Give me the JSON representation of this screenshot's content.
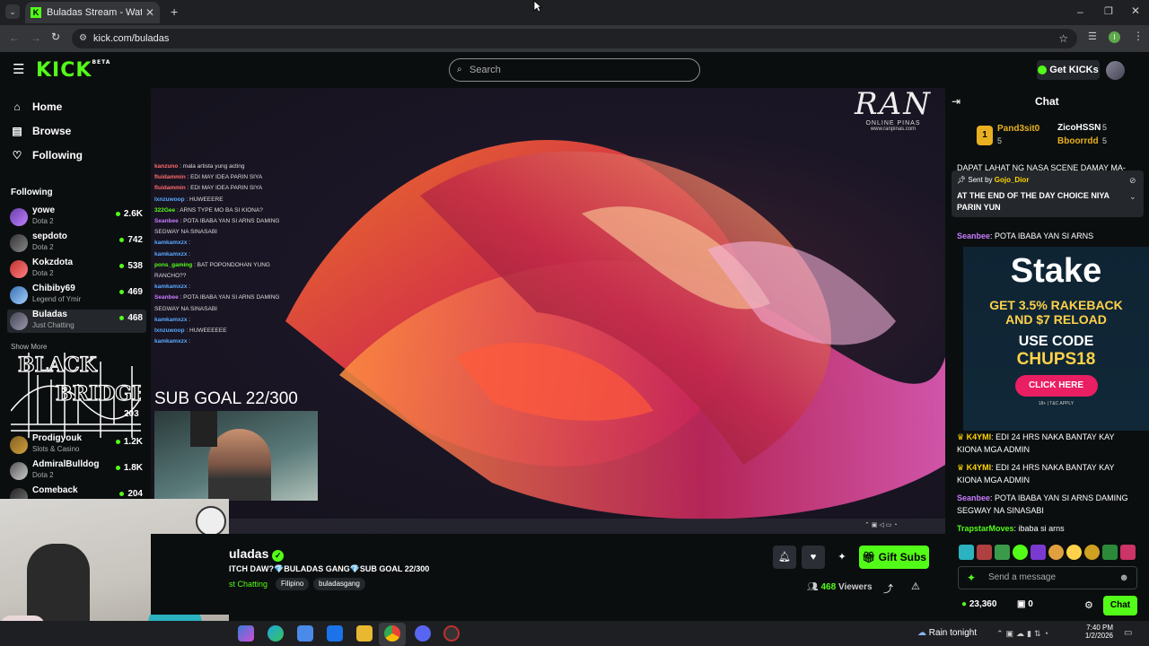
{
  "browser": {
    "tab_title": "Buladas Stream - Watch Live o",
    "url": "kick.com/buladas",
    "new_tab": "+",
    "close_tab": "✕"
  },
  "kick": {
    "logo": "KICK",
    "logo_badge": "BETA",
    "search_placeholder": "Search",
    "get_kicks": "Get KICKs"
  },
  "sidebar": {
    "nav": [
      {
        "label": "Home"
      },
      {
        "label": "Browse"
      },
      {
        "label": "Following"
      }
    ],
    "following_heading": "Following",
    "channels": [
      {
        "name": "yowe",
        "category": "Dota 2",
        "viewers": "2.6K"
      },
      {
        "name": "sepdoto",
        "category": "Dota 2",
        "viewers": "742"
      },
      {
        "name": "Kokzdota",
        "category": "Dota 2",
        "viewers": "538"
      },
      {
        "name": "Chibiby69",
        "category": "Legend of Ymir",
        "viewers": "469"
      },
      {
        "name": "Buladas",
        "category": "Just Chatting",
        "viewers": "468"
      }
    ],
    "show_more": "Show More",
    "partial_viewers_1": "203",
    "partial_viewers_2": "1.2K",
    "partial_name_2": "Prodigyouk",
    "partial_cat_2": "Slots & Casino",
    "channels_2": [
      {
        "name": "AdmiralBulldog",
        "category": "Dota 2",
        "viewers": "1.8K"
      },
      {
        "name": "Comeback",
        "category": "",
        "viewers": "204"
      }
    ]
  },
  "video": {
    "logo_text": "RAN",
    "logo_sub": "ONLINE PINAS",
    "logo_url": "www.ranpinas.com",
    "sub_goal": "SUB GOAL 22/300",
    "black_bridge_line1": "BLACK",
    "black_bridge_line2": "BRIDGE",
    "overlay_chat": [
      {
        "user": "kanzuno",
        "text": "mala artista yung acting",
        "color": "#ff6b6b"
      },
      {
        "user": "fluidammin",
        "text": "EDI MAY IDEA PARIN SIYA",
        "color": "#ff6b6b"
      },
      {
        "user": "fluidammin",
        "text": "EDI MAY IDEA PARIN SIYA",
        "color": "#ff6b6b"
      },
      {
        "user": "lxnzuwoop",
        "text": "HUWEEERE",
        "color": "#5aa9ff"
      },
      {
        "user": "322Gee",
        "text": "ARNS TYPE MO BA SI KIONA?",
        "color": "#53fc18"
      },
      {
        "user": "Seanbee",
        "text": "POTA IBABA YAN SI ARNS DAMING SEGWAY NA SINASABI",
        "color": "#c77dff"
      },
      {
        "user": "kamkamxzx",
        "text": "",
        "color": "#5aa9ff"
      },
      {
        "user": "kamkamxzx",
        "text": "",
        "color": "#5aa9ff"
      },
      {
        "user": "pons_gaming",
        "text": "BAT POPONDOHAN YUNG RANCHO??",
        "color": "#53fc18"
      },
      {
        "user": "kamkamxzx",
        "text": "",
        "color": "#5aa9ff"
      },
      {
        "user": "Seanbee",
        "text": "POTA IBABA YAN SI ARNS DAMING SEGWAY NA SINASABI",
        "color": "#c77dff"
      },
      {
        "user": "kamkamxzx",
        "text": "",
        "color": "#5aa9ff"
      },
      {
        "user": "lxnzuwoop",
        "text": "HUWEEEEEE",
        "color": "#5aa9ff"
      },
      {
        "user": "kamkamxzx",
        "text": "",
        "color": "#5aa9ff"
      }
    ]
  },
  "stream": {
    "streamer": "uladas",
    "title": "ITCH DAW?💎BULADAS GANG💎SUB GOAL 22/300",
    "category": "st Chatting",
    "tags": [
      "Filipino",
      "buladasgang"
    ],
    "gift_subs": "Gift Subs",
    "viewers": "468",
    "viewers_label": "Viewers"
  },
  "chat": {
    "title": "Chat",
    "leaderboard": [
      {
        "rank": "1",
        "name": "Pand3sit0",
        "count": "5"
      },
      {
        "name": "ZicoHSSN",
        "count": "5"
      },
      {
        "name": "Bboorrdd",
        "count": "5"
      }
    ],
    "truncated_msg": "DAPAT LAHAT NG NASA SCENE DAMAY MA-",
    "pinned": {
      "sent_by_label": "Sent by",
      "sender": "Gojo_Dior",
      "text": "AT THE END OF THE DAY CHOICE NIYA PARIN YUN"
    },
    "messages": [
      {
        "user": "Seanbee",
        "text": "POTA IBABA YAN SI ARNS",
        "color": "#c77dff"
      },
      {
        "user": "K4YMI",
        "text": "EDI 24 HRS NAKA BANTAY KAY KIONA MGA ADMIN",
        "color": "#ffd400"
      },
      {
        "user": "K4YMI",
        "text": "EDI 24 HRS NAKA BANTAY KAY KIONA MGA ADMIN",
        "color": "#ffd400"
      },
      {
        "user": "Seanbee",
        "text": "POTA IBABA YAN SI ARNS DAMING SEGWAY NA SINASABI",
        "color": "#c77dff"
      },
      {
        "user": "TrapstarMoves",
        "text": "ibaba si arns",
        "color": "#53fc18"
      }
    ],
    "send_placeholder": "Send a message",
    "balance": "23,360",
    "gifts": "0",
    "chat_button": "Chat"
  },
  "ad": {
    "brand": "Stake",
    "line1": "GET 3.5% RAKEBACK",
    "line2": "AND $7 RELOAD",
    "line3": "USE CODE",
    "code": "CHUPS18",
    "cta": "CLICK HERE",
    "fine_print": "18+ | T&C APPLY"
  },
  "taskbar": {
    "weather": "Rain tonight",
    "time": "7:40 PM",
    "date": "1/2/2026"
  },
  "colors": {
    "kick_green": "#53fc18",
    "bg": "#0b0e0f",
    "stake_pink": "#e91e63"
  }
}
